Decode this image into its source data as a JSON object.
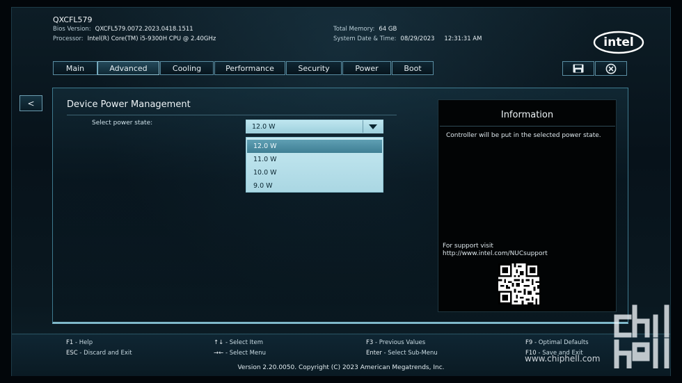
{
  "header": {
    "board": "QXCFL579",
    "bios_label": "Bios Version:",
    "bios_value": "QXCFL579.0072.2023.0418.1511",
    "proc_label": "Processor:",
    "proc_value": "Intel(R) Core(TM) i5-9300H CPU @ 2.40GHz",
    "mem_label": "Total Memory:",
    "mem_value": "64 GB",
    "dt_label": "System Date & Time:",
    "date": "08/29/2023",
    "time": "12:31:31 AM"
  },
  "tabs": [
    {
      "label": "Main"
    },
    {
      "label": "Advanced",
      "active": true
    },
    {
      "label": "Cooling"
    },
    {
      "label": "Performance"
    },
    {
      "label": "Security"
    },
    {
      "label": "Power"
    },
    {
      "label": "Boot"
    }
  ],
  "toolbar": {
    "back_label": "<"
  },
  "page": {
    "section_title": "Device Power Management",
    "field_label": "Select power state:",
    "selected_value": "12.0 W",
    "options": [
      "12.0 W",
      "11.0 W",
      "10.0 W",
      "9.0 W"
    ]
  },
  "info": {
    "title": "Information",
    "text": "Controller will be put in the selected power state.",
    "support_line1": "For support visit",
    "support_line2": "http://www.intel.com/NUCsupport"
  },
  "footer": {
    "f1": "F1",
    "f1_desc": "- Help",
    "esc": "ESC",
    "esc_desc": "- Discard and Exit",
    "arrows": "↑↓",
    "arrows_desc": "- Select Item",
    "tab": "→←",
    "tab_desc": "- Select Menu",
    "f3": "F3",
    "f3_desc": "- Previous Values",
    "enter": "Enter",
    "enter_desc": "- Select Sub-Menu",
    "f9": "F9",
    "f9_desc": "- Optimal Defaults",
    "f10": "F10",
    "f10_desc": "- Save and Exit",
    "copyright": "Version 2.20.0050. Copyright (C) 2023 American Megatrends, Inc."
  },
  "watermark": {
    "text": "www.chiphell.com",
    "logo_text": "chip hell"
  },
  "logo": {
    "text": "intel"
  },
  "colors": {
    "accent": "#5a8ea3",
    "select_bg": "#bfe6ef",
    "highlight": "#3f7f94"
  }
}
